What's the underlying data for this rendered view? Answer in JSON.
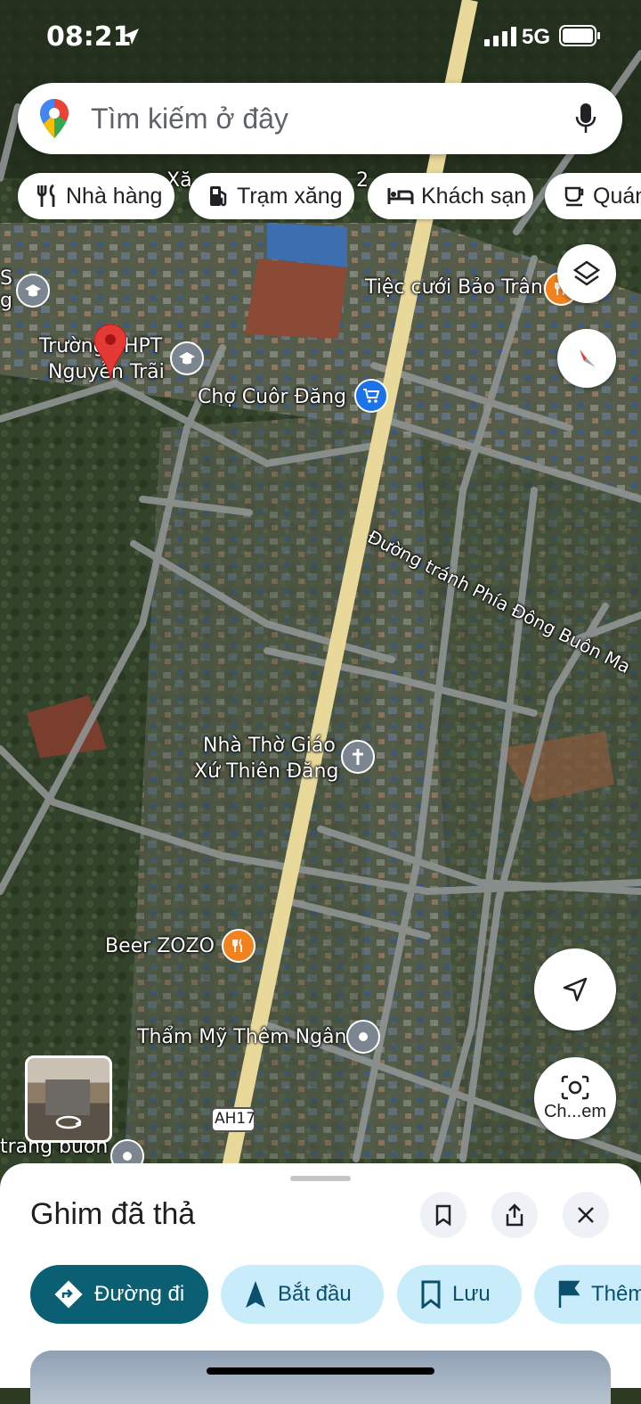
{
  "status": {
    "time": "08:21",
    "network": "5G"
  },
  "search": {
    "placeholder": "Tìm kiếm ở đây",
    "icons": [
      "google-maps-pin-icon",
      "microphone-icon"
    ]
  },
  "chips": [
    {
      "label": "Nhà hàng",
      "icon": "fork-knife-icon"
    },
    {
      "label": "Trạm xăng",
      "icon": "gas-pump-icon"
    },
    {
      "label": "Khách sạn",
      "icon": "bed-icon"
    },
    {
      "label": "Quán",
      "icon": "coffee-cup-icon"
    }
  ],
  "map_labels": {
    "top_partial": "Xă",
    "top_partial_num": "2",
    "wedding": "Tiệc cưới Bảo Trân",
    "school_1": "Trường THPT",
    "school_2": "Nguyễn Trãi",
    "market": "Chợ Cuôr Đăng",
    "road_bypass": "Đường tránh Phía Đông Buôn Ma",
    "church_1": "Nhà Thờ Giáo",
    "church_2": "Xứ Thiên Đăng",
    "beer": "Beer ZOZO",
    "salon": "Thẩm Mỹ Thêm Ngân",
    "left_partial": "trang buôn",
    "highway": "AH17",
    "edge_partial": "S",
    "edge_partial_2": "g"
  },
  "colors": {
    "accent": "#0b5f73",
    "chip_bg": "#c9ecfb",
    "pin": "#e53935",
    "road_yellow": "#e8d89a",
    "market_blue": "#1a73e8",
    "food_orange": "#f0831e",
    "poi_gray": "#7b8691"
  },
  "fabs": {
    "camera_label": "Ch...em"
  },
  "sheet": {
    "title": "Ghim đã thả",
    "actions": [
      {
        "label": "Đường đi",
        "icon": "directions-icon"
      },
      {
        "label": "Bắt đầu",
        "icon": "navigation-arrow-icon"
      },
      {
        "label": "Lưu",
        "icon": "bookmark-icon"
      },
      {
        "label": "Thêm",
        "icon": "flag-icon"
      }
    ]
  }
}
